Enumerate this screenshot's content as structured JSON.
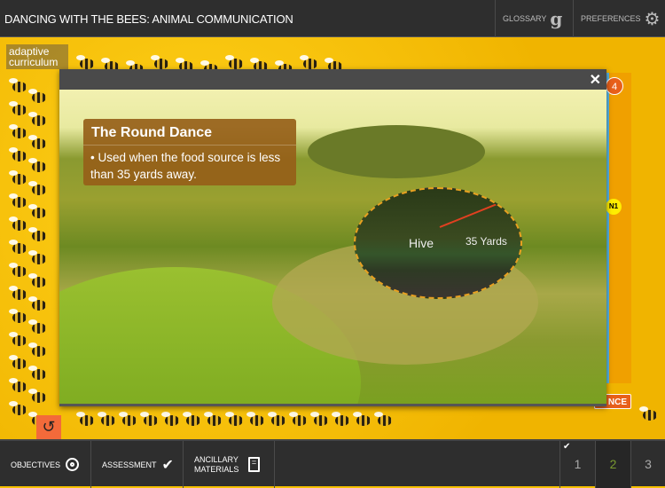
{
  "header": {
    "title": "DANCING WITH THE BEES: ANIMAL COMMUNICATION",
    "glossary_label": "GLOSSARY",
    "glossary_icon": "g",
    "preferences_label": "PREFERENCES"
  },
  "logo": {
    "line1": "adaptive",
    "line2": "curriculum"
  },
  "side": {
    "badge": "4",
    "marker": "N1",
    "button_partial": "NCE"
  },
  "modal": {
    "close": "✕",
    "card_title": "The Round Dance",
    "card_bullet": "• Used when the food source is less than 35 yards away.",
    "hive_label": "Hive",
    "distance_label": "35 Yards"
  },
  "bottom": {
    "objectives": "OBJECTIVES",
    "assessment": "ASSESSMENT",
    "ancillary": "ANCILLARY MATERIALS",
    "pages": [
      "1",
      "2",
      "3"
    ],
    "current_page": "2",
    "completed_page": "1"
  },
  "colors": {
    "accent_orange": "#f36a3a",
    "current_page": "#7a9a30"
  }
}
